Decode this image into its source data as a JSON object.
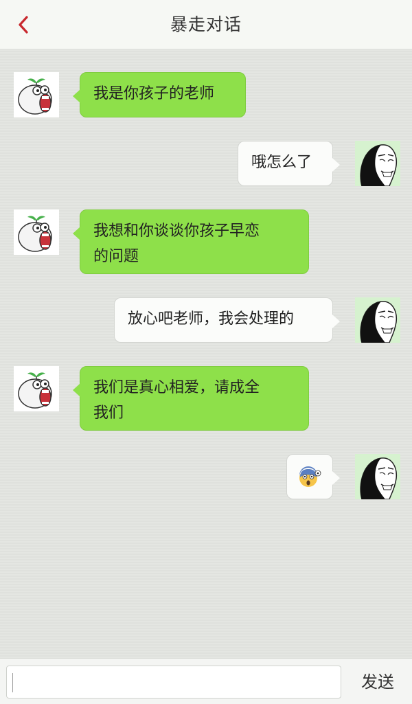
{
  "header": {
    "title": "暴走对话",
    "back_icon": "chevron-left-icon",
    "accent_color": "#c8282d"
  },
  "messages": [
    {
      "side": "left",
      "sender": "teacher",
      "lines": [
        "我是你孩子的老师"
      ]
    },
    {
      "side": "right",
      "sender": "parent",
      "lines": [
        "哦怎么了"
      ]
    },
    {
      "side": "left",
      "sender": "teacher",
      "lines": [
        "我想和你谈谈你孩子早恋",
        "的问题"
      ]
    },
    {
      "side": "right",
      "sender": "parent",
      "lines": [
        "放心吧老师，我会处理的"
      ]
    },
    {
      "side": "left",
      "sender": "teacher",
      "lines": [
        "我们是真心相爱，请成全",
        "我们"
      ]
    },
    {
      "side": "right",
      "sender": "parent",
      "content": "scared-face-emoji-icon"
    }
  ],
  "input": {
    "value": "",
    "placeholder": ""
  },
  "send_label": "发送",
  "colors": {
    "left_bubble": "#8ee04a",
    "right_bubble": "#fbfcfa",
    "chat_bg": "#e4e6e2"
  }
}
